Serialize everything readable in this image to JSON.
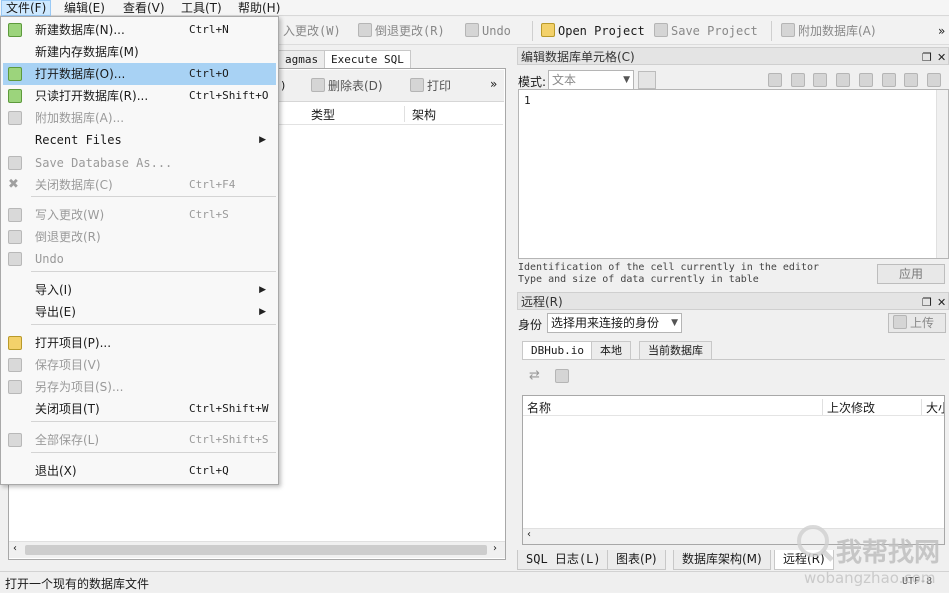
{
  "menubar": [
    {
      "label": "文件(F)",
      "active": true
    },
    {
      "label": "编辑(E)"
    },
    {
      "label": "查看(V)"
    },
    {
      "label": "工具(T)"
    },
    {
      "label": "帮助(H)"
    }
  ],
  "toolbar": {
    "write_changes": "入更改(W)",
    "revert_changes": "倒退更改(R)",
    "undo": "Undo",
    "open_project": "Open Project",
    "save_project": "Save Project",
    "attach_db": "附加数据库(A)",
    "more": "»"
  },
  "left": {
    "tabs": [
      "agmas",
      "Execute SQL"
    ],
    "delete_table": "删除表(D)",
    "print": "打印",
    "partial_shortcut": ")",
    "more": "»",
    "columns": [
      "类型",
      "架构"
    ]
  },
  "file_menu": {
    "items": [
      {
        "label": "新建数据库(N)...",
        "shortcut": "Ctrl+N",
        "icon": "new-db-icon"
      },
      {
        "label": "新建内存数据库(M)",
        "shortcut": ""
      },
      {
        "label": "打开数据库(O)...",
        "shortcut": "Ctrl+O",
        "icon": "open-db-icon",
        "highlighted": true
      },
      {
        "label": "只读打开数据库(R)...",
        "shortcut": "Ctrl+Shift+O",
        "icon": "open-readonly-icon"
      },
      {
        "label": "附加数据库(A)...",
        "shortcut": "",
        "disabled": true,
        "icon": "attach-db-icon"
      },
      {
        "label": "Recent Files",
        "submenu": true
      },
      {
        "label": "Save Database As...",
        "shortcut": "",
        "disabled": true,
        "icon": "save-as-icon"
      },
      {
        "label": "关闭数据库(C)",
        "shortcut": "Ctrl+F4",
        "disabled": true,
        "icon": "close-db-icon"
      },
      {
        "label": "写入更改(W)",
        "shortcut": "Ctrl+S",
        "disabled": true,
        "icon": "write-changes-icon"
      },
      {
        "label": "倒退更改(R)",
        "shortcut": "",
        "disabled": true,
        "icon": "revert-icon"
      },
      {
        "label": "Undo",
        "shortcut": "",
        "disabled": true,
        "icon": "undo-icon"
      },
      {
        "label": "导入(I)",
        "submenu": true
      },
      {
        "label": "导出(E)",
        "submenu": true
      },
      {
        "label": "打开项目(P)...",
        "shortcut": "",
        "icon": "open-project-icon"
      },
      {
        "label": "保存项目(V)",
        "shortcut": "",
        "disabled": true,
        "icon": "save-project-icon"
      },
      {
        "label": "另存为项目(S)...",
        "shortcut": "",
        "disabled": true,
        "icon": "save-project-as-icon"
      },
      {
        "label": "关闭项目(T)",
        "shortcut": "Ctrl+Shift+W"
      },
      {
        "label": "全部保存(L)",
        "shortcut": "Ctrl+Shift+S",
        "disabled": true,
        "icon": "save-all-icon"
      },
      {
        "label": "退出(X)",
        "shortcut": "Ctrl+Q"
      }
    ]
  },
  "edit_cell": {
    "title": "编辑数据库单元格(C)",
    "mode_label": "模式:",
    "mode_value": "文本",
    "line_number": "1",
    "info_line1": "Identification of the cell currently in the editor",
    "info_line2": "Type and size of data currently in table",
    "apply": "应用"
  },
  "remote": {
    "title": "远程(R)",
    "identity_label": "身份",
    "identity_value": "选择用来连接的身份",
    "upload": "上传",
    "tabs": [
      "DBHub.io",
      "本地",
      "当前数据库"
    ],
    "columns": [
      "名称",
      "上次修改",
      "大小"
    ]
  },
  "bottom_tabs": [
    "SQL 日志(L)",
    "图表(P)",
    "数据库架构(M)",
    "远程(R)"
  ],
  "status": {
    "message": "打开一个现有的数据库文件",
    "encoding": "UTF-8"
  },
  "watermark": {
    "cn": "我帮找网",
    "url": "wobangzhao.com"
  },
  "colors": {
    "menu_highlight": "#a8d2f4",
    "disabled_text": "#9a9a9a",
    "icon_green": "#5d9a3c"
  }
}
